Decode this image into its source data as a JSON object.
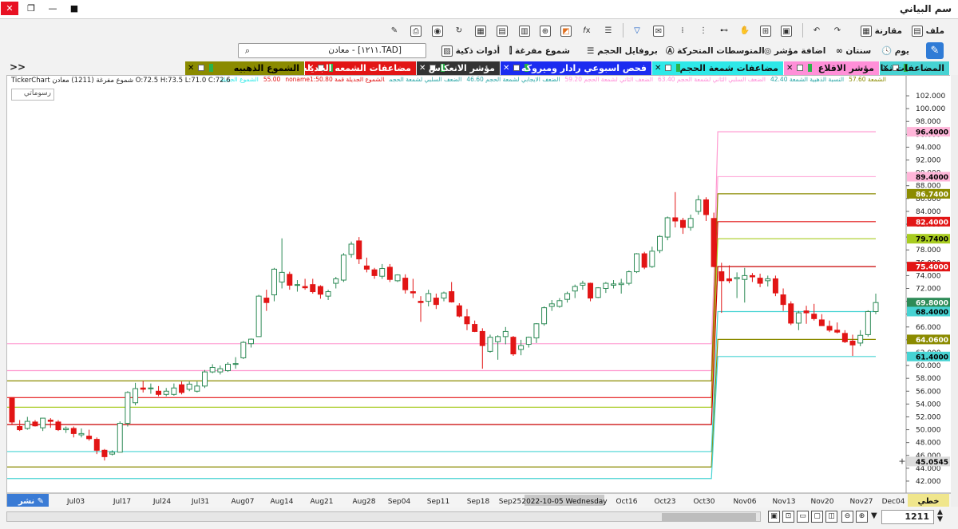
{
  "window": {
    "title": "سم البياني",
    "close": "✕",
    "restore": "❐",
    "minimize": "—",
    "record": "■"
  },
  "toolbar1": {
    "file": "ملف",
    "compare": "مقارنة"
  },
  "toolbar2": {
    "day": "يوم",
    "years": "سنتان",
    "add_indicator": "اضافة مؤشر",
    "moving_averages": "المتوسطات المتحركة",
    "volume_profile": "بروفايل الحجم",
    "hollow_candles": "شموع مفرغة",
    "smart_tools": "أدوات ذكية",
    "search_value": "[TAD.١٢١١] - معادن"
  },
  "tabs": [
    {
      "label": "المضاعفات ثماني",
      "color": "#47d3d3"
    },
    {
      "label": "مؤشر الاقلاع",
      "color": "#ff8fd8"
    },
    {
      "label": "مضاعفات شمعة الحجم",
      "color": "#2ee8e8"
    },
    {
      "label": "فحص اسبوعي رادار وميروكه",
      "color": "#1b2cf0"
    },
    {
      "label": "مؤشر الانعكاس",
      "color": "#333333"
    },
    {
      "label": "مضاعفات الشمعه الجديله",
      "color": "#e21515"
    },
    {
      "label": "الشموع الذهبيه",
      "color": "#8b8b00"
    }
  ],
  "tabs_more": ">>",
  "legend": [
    {
      "text": "الشمعة 57.60",
      "color": "#8b8b00"
    },
    {
      "text": "النسبة الذهبية الشمعة 42.40",
      "color": "#2aa6a6"
    },
    {
      "text": "الضعف السلبي الثاني لشمعة الحجم 63.40",
      "color": "#ff8fd8"
    },
    {
      "text": "الضعف الثاني لشمعة الحجم 59.20",
      "color": "#ff8fd8"
    },
    {
      "text": "الضعف الايجابي لشمعة الحجم 46.60",
      "color": "#2aa6a6"
    },
    {
      "text": "الضعف السلبي لشمعة الحجم",
      "color": "#2aa6a6"
    },
    {
      "text": "الشموع الجديلة قمة 55.00",
      "color": "#e21515"
    },
    {
      "text": "noname1:50.80",
      "color": "#e21515"
    },
    {
      "text": "الشموع الجديلة",
      "color": "#2ee8e8"
    }
  ],
  "ohlc": "TickerChart شموع مفرغة (1211) معادن O:72.5 H:73.5 L:71.0 C:72.6",
  "drawings_label": "رسوماتي",
  "chart_data": {
    "type": "candlestick",
    "y_range": [
      41,
      103
    ],
    "y_ticks": [
      42,
      44,
      46,
      48,
      50,
      52,
      54,
      56,
      58,
      60,
      62,
      64,
      66,
      68,
      70,
      72,
      74,
      76,
      78,
      80,
      82,
      84,
      86,
      88,
      90,
      92,
      94,
      96,
      98,
      100,
      102
    ],
    "x_labels": [
      "Jul03",
      "Jul17",
      "Jul24",
      "Jul31",
      "Aug07",
      "Aug14",
      "Aug21",
      "Aug28",
      "Sep04",
      "Sep11",
      "Sep18",
      "Sep25",
      "Oct16",
      "Oct23",
      "Oct30",
      "Nov06",
      "Nov13",
      "Nov20",
      "Nov27",
      "Dec04"
    ],
    "crosshair_date": "2022-10-05 Wednesday",
    "axis_badges": [
      {
        "value": "96.4000",
        "color": "#ffb6d9",
        "text_color": "#000000"
      },
      {
        "value": "89.4000",
        "color": "#ffb6d9",
        "text_color": "#000000"
      },
      {
        "value": "86.7400",
        "color": "#8b8b00",
        "text_color": "#ffffff"
      },
      {
        "value": "82.4000",
        "color": "#e21515",
        "text_color": "#ffffff"
      },
      {
        "value": "79.7400",
        "color": "#a8cc20",
        "text_color": "#000000"
      },
      {
        "value": "75.4000",
        "color": "#e21515",
        "text_color": "#ffffff"
      },
      {
        "value": "69.8000",
        "color": "#2e8b57",
        "text_color": "#ffffff"
      },
      {
        "value": "68.4000",
        "color": "#47d3d3",
        "text_color": "#000000"
      },
      {
        "value": "64.0600",
        "color": "#8b8b00",
        "text_color": "#ffffff"
      },
      {
        "value": "61.4000",
        "color": "#47d3d3",
        "text_color": "#000000"
      },
      {
        "value": "45.0545",
        "color": "#dcdcdc",
        "text_color": "#000000"
      }
    ],
    "step_lines": [
      {
        "color": "#ff9ad0",
        "before": 59.2,
        "after": 96.4
      },
      {
        "color": "#ffa8d8",
        "before": 63.4,
        "after": 89.4
      },
      {
        "color": "#8b8b00",
        "before": 57.6,
        "after": 86.74
      },
      {
        "color": "#e21515",
        "before": 55.0,
        "after": 82.4
      },
      {
        "color": "#a8cc20",
        "before": 53.5,
        "after": 79.74
      },
      {
        "color": "#c80000",
        "before": 50.8,
        "after": 75.4
      },
      {
        "color": "#47d3d3",
        "before": 46.6,
        "after": 68.4
      },
      {
        "color": "#8b8b00",
        "before": 44.2,
        "after": 64.06
      },
      {
        "color": "#47d3d3",
        "before": 42.4,
        "after": 61.4
      }
    ],
    "candles": [
      [
        55,
        55,
        50.8,
        51.2
      ],
      [
        50.5,
        51.5,
        49.8,
        50
      ],
      [
        50.2,
        52,
        50,
        51.3
      ],
      [
        51.2,
        51.5,
        50.5,
        50.6
      ],
      [
        50.3,
        51.8,
        49.8,
        51.8
      ],
      [
        51.5,
        51.8,
        50.3,
        51.3
      ],
      [
        51.2,
        51.5,
        49.8,
        50
      ],
      [
        50,
        50.5,
        49.5,
        50.2
      ],
      [
        50.2,
        50.5,
        48.8,
        49.4
      ],
      [
        49.2,
        50.2,
        48.8,
        49.4
      ],
      [
        49,
        50,
        48.3,
        48.6
      ],
      [
        48.5,
        48.8,
        46.2,
        46.8
      ],
      [
        46.8,
        47,
        45.2,
        45.8
      ],
      [
        46.2,
        46.8,
        46,
        46.5
      ],
      [
        46.5,
        51.3,
        46.5,
        51
      ],
      [
        51,
        56,
        50.5,
        55.8
      ],
      [
        54.2,
        57.3,
        53.8,
        56.4
      ],
      [
        56.5,
        57.6,
        55.8,
        56.3
      ],
      [
        56.5,
        57.2,
        55.6,
        56.5
      ],
      [
        56,
        56.8,
        55.2,
        55.5
      ],
      [
        55.5,
        56.5,
        55.2,
        56
      ],
      [
        55.5,
        57.2,
        55.3,
        56.5
      ],
      [
        57,
        57.5,
        55.5,
        55.8
      ],
      [
        56.3,
        57.5,
        56,
        57.1
      ],
      [
        56,
        57.5,
        55.8,
        56.8
      ],
      [
        56.8,
        59.3,
        56.5,
        59
      ],
      [
        59,
        60.2,
        58.8,
        59.7
      ],
      [
        59,
        60,
        58.6,
        59.5
      ],
      [
        59.2,
        60.5,
        59,
        60.2
      ],
      [
        60.2,
        61.3,
        59.5,
        60.3
      ],
      [
        61.2,
        63.8,
        61,
        63.6
      ],
      [
        63.4,
        64.2,
        62.8,
        64.1
      ],
      [
        64.5,
        71,
        64.5,
        70.8
      ],
      [
        70.5,
        71.8,
        68.5,
        69.8
      ],
      [
        71,
        75.2,
        70,
        75
      ],
      [
        73,
        79.8,
        72,
        74.5
      ],
      [
        74.2,
        74.6,
        71.8,
        72.5
      ],
      [
        72.5,
        73.3,
        71.5,
        72.6
      ],
      [
        72.3,
        73.5,
        71.8,
        72.1
      ],
      [
        72.6,
        73.5,
        71.2,
        71.5
      ],
      [
        72.3,
        72.5,
        70.4,
        71.1
      ],
      [
        70.8,
        71.8,
        70.2,
        71.5
      ],
      [
        72.8,
        73.8,
        72,
        73.5
      ],
      [
        73.3,
        77.5,
        73,
        77.2
      ],
      [
        77.3,
        79.3,
        76.8,
        78.9
      ],
      [
        79.4,
        80,
        75.8,
        76.6
      ],
      [
        75.5,
        76.8,
        74.5,
        75
      ],
      [
        74.9,
        75.2,
        73.5,
        74
      ],
      [
        73.9,
        75.8,
        73.5,
        75.1
      ],
      [
        75.3,
        75.8,
        73,
        73.4
      ],
      [
        73.2,
        74.2,
        73,
        74.1
      ],
      [
        73.6,
        74.2,
        71.2,
        71.8
      ],
      [
        71.5,
        73.5,
        70.5,
        71.3
      ],
      [
        70,
        70.8,
        66.8,
        69.8
      ],
      [
        70,
        71.8,
        69.2,
        71.2
      ],
      [
        70.5,
        71.2,
        68.8,
        69.5
      ],
      [
        70.5,
        71.5,
        70,
        71.3
      ],
      [
        71.5,
        73,
        69.8,
        69.9
      ],
      [
        69.3,
        69.7,
        67.5,
        67.7
      ],
      [
        67.6,
        68.8,
        65.5,
        66.5
      ],
      [
        66.4,
        67,
        65.2,
        65.3
      ],
      [
        65.3,
        65.8,
        59.5,
        63.1
      ],
      [
        62.2,
        64.8,
        62,
        64.4
      ],
      [
        63.7,
        64.7,
        60.9,
        64.5
      ],
      [
        64.5,
        66,
        63.3,
        65.3
      ],
      [
        64.4,
        64.6,
        61.5,
        61.8
      ],
      [
        62.5,
        64,
        61.6,
        63.1
      ],
      [
        63.3,
        64.5,
        62.8,
        64.4
      ],
      [
        64.3,
        66.6,
        63.5,
        66.5
      ],
      [
        66.5,
        69.2,
        66.2,
        69
      ],
      [
        69.2,
        70.2,
        68.5,
        69.6
      ],
      [
        69.2,
        70.5,
        69,
        70.1
      ],
      [
        70.3,
        71.5,
        69.8,
        71.2
      ],
      [
        71.6,
        72.6,
        70.5,
        72.3
      ],
      [
        72.5,
        73.2,
        71.8,
        72.8
      ],
      [
        72.8,
        72.9,
        70,
        70.5
      ],
      [
        70.6,
        72.2,
        70.5,
        72.1
      ],
      [
        72,
        73,
        71.3,
        72.8
      ],
      [
        72.5,
        73.3,
        72,
        72.7
      ],
      [
        72.6,
        73.5,
        71.2,
        72.8
      ],
      [
        72.8,
        74.8,
        72.5,
        74.6
      ],
      [
        74.6,
        77.5,
        74.4,
        77.4
      ],
      [
        77.4,
        77.7,
        75,
        75.3
      ],
      [
        75.4,
        78.5,
        75.2,
        77.8
      ],
      [
        77.9,
        80.3,
        77.5,
        80.1
      ],
      [
        80,
        83.2,
        79.5,
        83
      ],
      [
        83,
        87,
        81.5,
        82.5
      ],
      [
        82.6,
        83,
        80.5,
        81.5
      ],
      [
        81.5,
        83.5,
        81,
        82.9
      ],
      [
        84,
        86.5,
        83.5,
        85.8
      ],
      [
        85.8,
        86.2,
        82.5,
        83.5
      ],
      [
        82.9,
        83.8,
        75.3,
        75.4
      ],
      [
        74.6,
        76,
        68.2,
        73.2
      ],
      [
        73.5,
        75.6,
        72.8,
        73.2
      ],
      [
        73.5,
        74.5,
        70.5,
        73.7
      ],
      [
        73.4,
        75.2,
        69.8,
        74
      ],
      [
        74,
        74.4,
        73,
        73.8
      ],
      [
        73.6,
        74.3,
        72.2,
        72.8
      ],
      [
        73.2,
        74,
        72.3,
        73.5
      ],
      [
        73.5,
        74,
        70.8,
        71.3
      ],
      [
        71,
        72,
        68.5,
        69.5
      ],
      [
        69.6,
        70,
        66.3,
        66.6
      ],
      [
        66.6,
        68.5,
        65.5,
        68.2
      ],
      [
        68.5,
        69.3,
        66.5,
        68.2
      ],
      [
        68,
        69.6,
        67,
        67.3
      ],
      [
        67.1,
        68,
        66.2,
        66.2
      ],
      [
        66.1,
        67,
        65.2,
        65.5
      ],
      [
        65.5,
        66.7,
        65,
        65.2
      ],
      [
        65,
        65.5,
        63.5,
        63.7
      ],
      [
        63.8,
        64.8,
        61.5,
        63.2
      ],
      [
        63.5,
        65.5,
        63,
        64.7
      ],
      [
        64.8,
        68.6,
        64.5,
        68.4
      ],
      [
        68.4,
        71.2,
        68,
        69.8
      ]
    ]
  },
  "bottom": {
    "zoom": "1211",
    "publish": "نشر",
    "ruler": "خطي"
  }
}
